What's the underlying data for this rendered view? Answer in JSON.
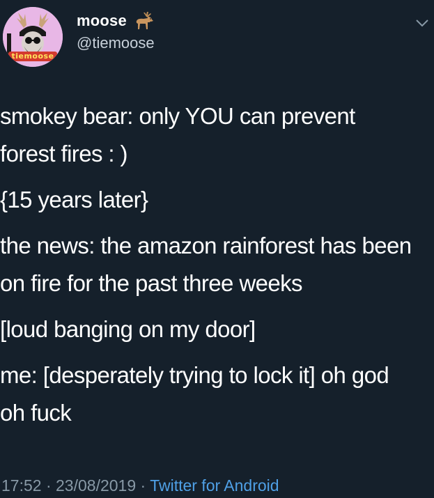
{
  "tweet": {
    "author": {
      "display_name": "moose",
      "name_emoji": "deer-icon",
      "handle": "@tiemoose",
      "avatar_icon": "avatar-image",
      "avatar_caption": "tiemoose",
      "avatar_bg": "#e8b7e6"
    },
    "menu_icon": "chevron-down-icon",
    "paragraphs": [
      "smokey bear: only YOU can prevent forest fires : )",
      "{15 years later}",
      "the news: the amazon rainforest has been on fire for the past three weeks",
      "[loud banging on my door]",
      "me: [desperately trying to lock it] oh god oh fuck"
    ],
    "meta": {
      "time": "17:52",
      "separator": "·",
      "date": "23/08/2019",
      "source": "Twitter for Android"
    }
  },
  "colors": {
    "background": "#15202b",
    "text": "#ffffff",
    "secondary": "#8899a6",
    "link": "#4fa0e6"
  }
}
